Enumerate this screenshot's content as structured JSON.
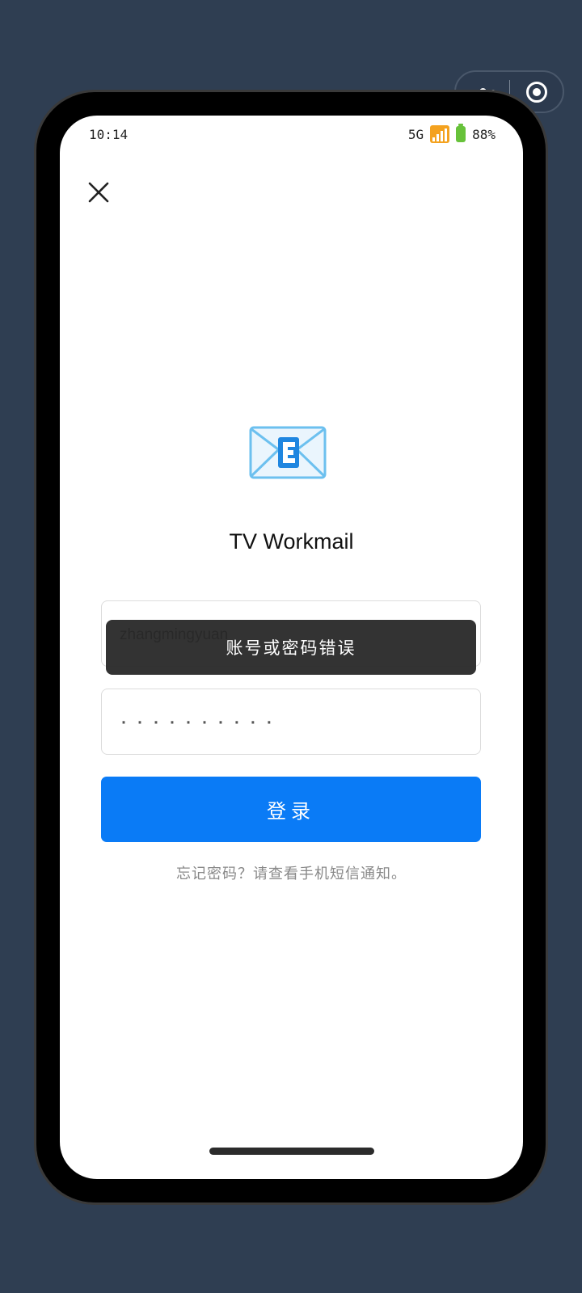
{
  "status": {
    "time": "10:14",
    "network": "5G",
    "battery": "88%"
  },
  "capsule": {
    "more_icon": "more-dots-icon",
    "close_icon": "target-circle-icon"
  },
  "close_icon": "close-x-icon",
  "logo_icon": "envelope-e-icon",
  "app_name": "TV Workmail",
  "form": {
    "username_value": "zhangmingyuan",
    "password_value": "··········",
    "login_label": "登录",
    "forgot_hint": "忘记密码？请查看手机短信通知。"
  },
  "toast": {
    "message": "账号或密码错误"
  },
  "colors": {
    "primary": "#0a7bf6",
    "background": "#2f3e52"
  }
}
